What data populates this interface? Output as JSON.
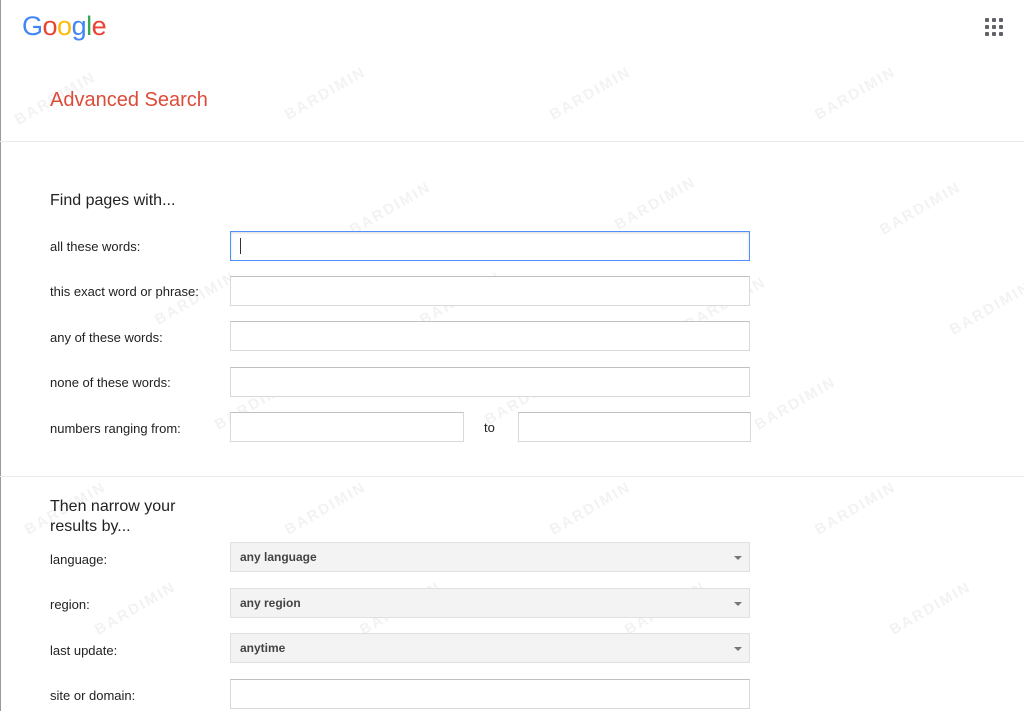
{
  "header": {
    "logo_letters": [
      {
        "ch": "G",
        "color": "#4285F4"
      },
      {
        "ch": "o",
        "color": "#EA4335"
      },
      {
        "ch": "o",
        "color": "#FBBC05"
      },
      {
        "ch": "g",
        "color": "#4285F4"
      },
      {
        "ch": "l",
        "color": "#34A853"
      },
      {
        "ch": "e",
        "color": "#EA4335"
      }
    ],
    "apps_icon": "apps-grid-icon",
    "page_title": "Advanced Search"
  },
  "find_section": {
    "title": "Find pages with...",
    "all_words_label": "all these words:",
    "exact_phrase_label": "this exact word or phrase:",
    "any_words_label": "any of these words:",
    "none_words_label": "none of these words:",
    "range_label": "numbers ranging from:",
    "range_to": "to"
  },
  "narrow_section": {
    "title_line1": "Then narrow your",
    "title_line2": "results by...",
    "language_label": "language:",
    "language_value": "any language",
    "region_label": "region:",
    "region_value": "any region",
    "last_update_label": "last update:",
    "last_update_value": "anytime",
    "site_label": "site or domain:"
  },
  "watermark": "BARDIMIN",
  "colors": {
    "title_red": "#dd4b39",
    "focus_blue": "#4d90fe"
  }
}
